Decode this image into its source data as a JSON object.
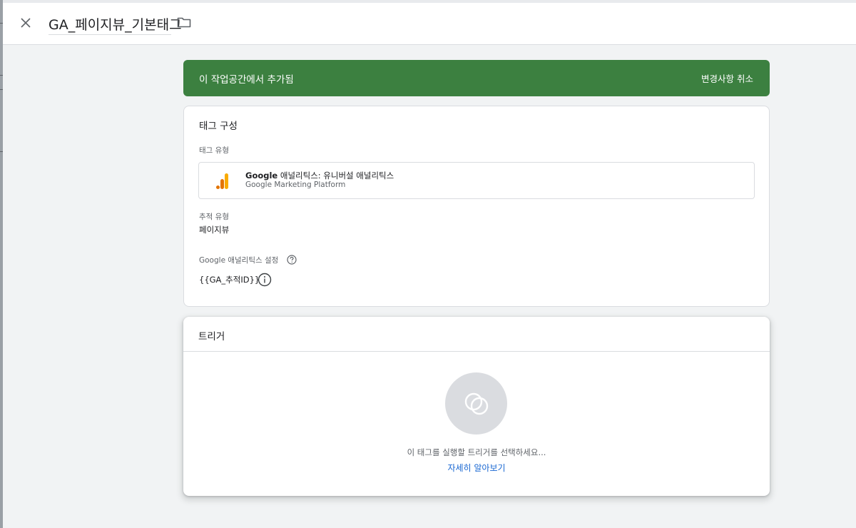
{
  "header": {
    "close_icon": "close-icon",
    "tag_name": "GA_페이지뷰_기본태그",
    "folder_icon": "folder-icon"
  },
  "banner": {
    "message": "이 작업공간에서 추가됨",
    "discard_label": "변경사항 취소",
    "color": "#3c8040"
  },
  "tag_config": {
    "title": "태그 구성",
    "tag_type_label": "태그 유형",
    "tag_type": {
      "name_bold": "Google",
      "name_rest": " 애널리틱스: 유니버설 애널리틱스",
      "provider": "Google Marketing Platform",
      "icon": "google-analytics-icon"
    },
    "track_type_label": "추적 유형",
    "track_type_value": "페이지뷰",
    "ga_settings_label": "Google 애널리틱스 설정",
    "ga_settings_value": "{{GA_추적ID}}"
  },
  "trigger": {
    "title": "트리거",
    "hint": "이 태그를 실행할 트리거를 선택하세요...",
    "learn_more": "자세히 알아보기",
    "link_color": "#1967d2"
  }
}
